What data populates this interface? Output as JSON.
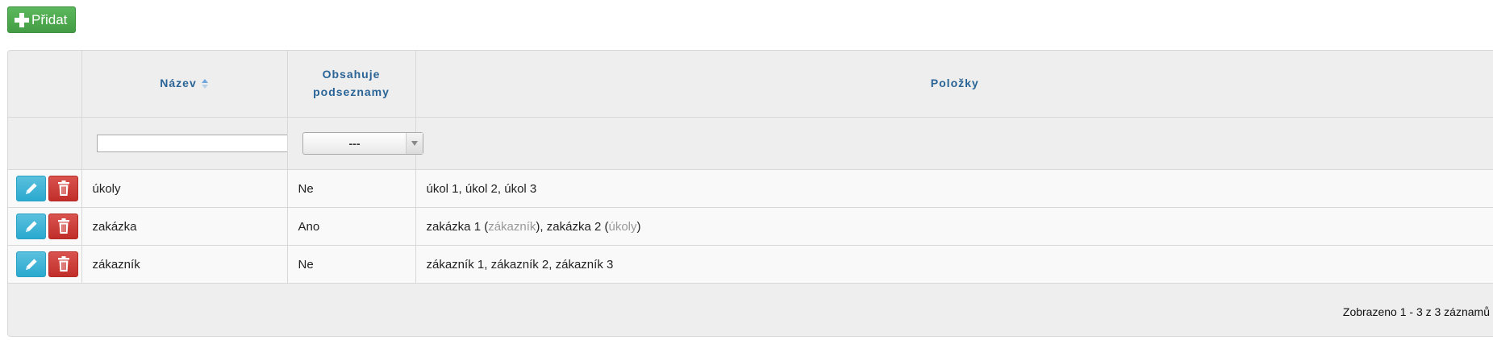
{
  "toolbar": {
    "add_label": "Přidat",
    "add_icon": "plus-icon"
  },
  "table": {
    "headers": {
      "name": "Název",
      "contains_sublists": "Obsahuje podseznamy",
      "items": "Položky"
    },
    "filters": {
      "name_value": "",
      "sublists_selected": "---"
    },
    "rows": [
      {
        "name": "úkoly",
        "contains_sublists": "Ne",
        "items": [
          {
            "text": "úkol 1"
          },
          {
            "text": "úkol 2"
          },
          {
            "text": "úkol 3"
          }
        ]
      },
      {
        "name": "zakázka",
        "contains_sublists": "Ano",
        "items": [
          {
            "text": "zakázka 1",
            "sublist": "zákazník"
          },
          {
            "text": "zakázka 2",
            "sublist": "úkoly"
          }
        ]
      },
      {
        "name": "zákazník",
        "contains_sublists": "Ne",
        "items": [
          {
            "text": "zákazník 1"
          },
          {
            "text": "zákazník 2"
          },
          {
            "text": "zákazník 3"
          }
        ]
      }
    ],
    "footer": "Zobrazeno 1 - 3 z 3 záznamů"
  },
  "colors": {
    "add_button": "#5cb85c",
    "edit_button": "#5bc0de",
    "delete_button": "#d9534f",
    "header_text": "#2a6496",
    "sublist_text": "#999999"
  }
}
